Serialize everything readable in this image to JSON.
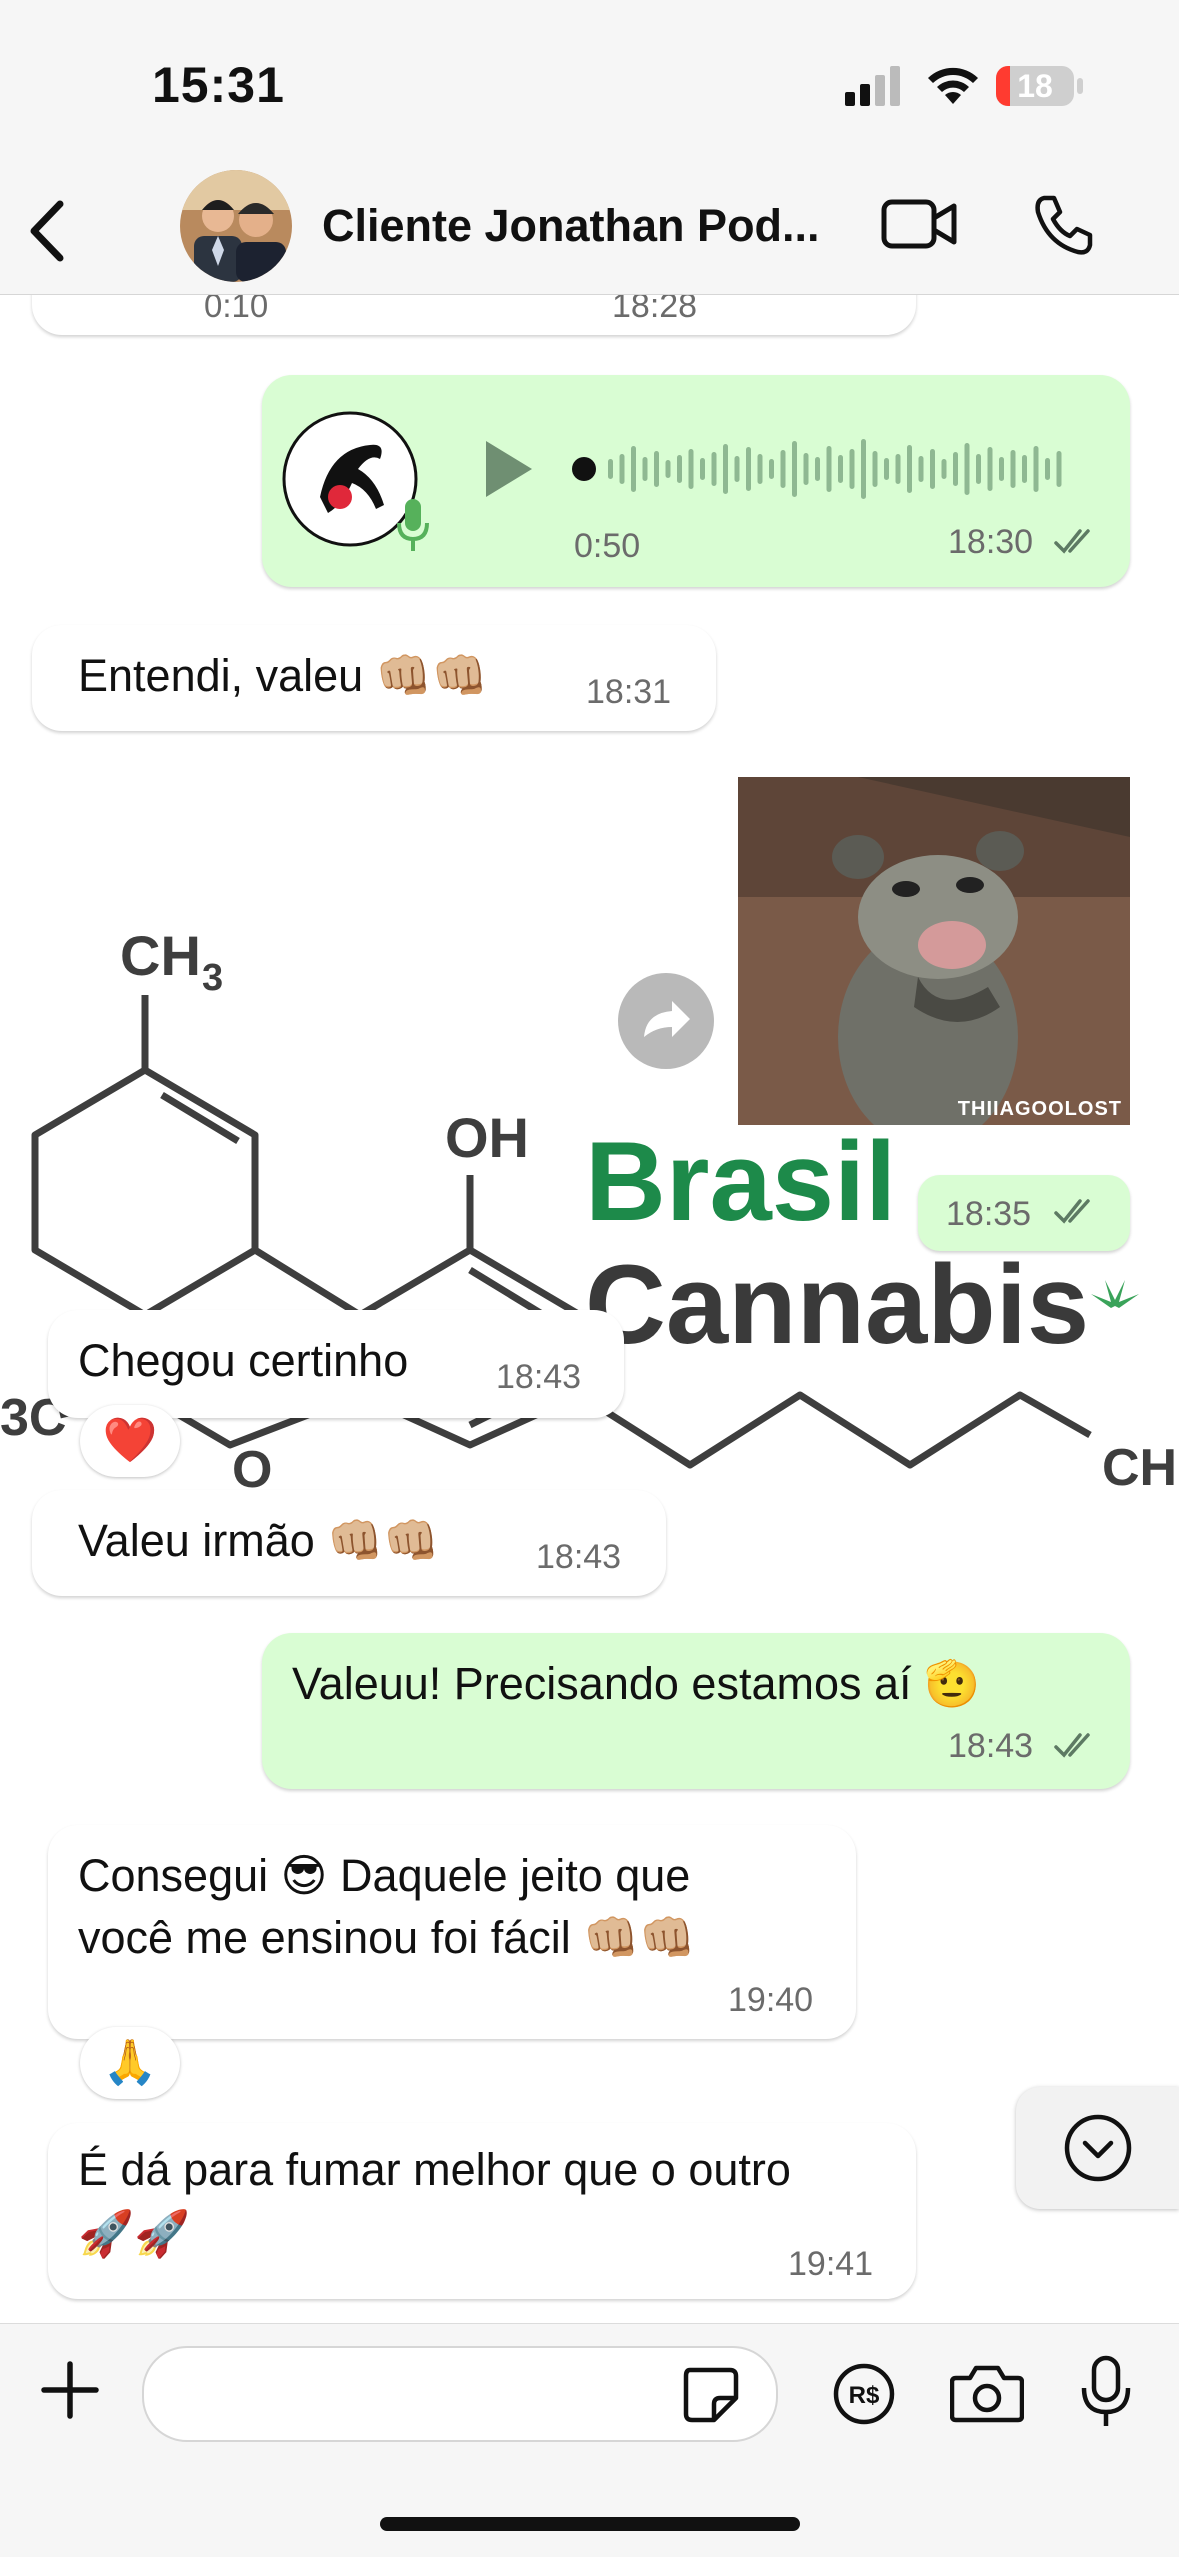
{
  "status_bar": {
    "time": "15:31",
    "battery": "18",
    "battery_level": 0.18,
    "battery_color": "#ff3b30"
  },
  "header": {
    "contact_name": "Cliente Jonathan Pod..."
  },
  "wallpaper": {
    "ch3_top": "CH",
    "oh": "OH",
    "brand_line1": "Brasil",
    "brand_line2": "Cannabis",
    "ch3_left": "3C",
    "o_label": "O",
    "ch_right": "CH",
    "brand_color": "#1d8a4a"
  },
  "messages": [
    {
      "id": "m0",
      "direction": "in",
      "type": "audio-partial",
      "duration": "0:10",
      "time": "18:28"
    },
    {
      "id": "m1",
      "direction": "out",
      "type": "audio",
      "duration": "0:50",
      "time": "18:30",
      "status": "read"
    },
    {
      "id": "m2",
      "direction": "in",
      "type": "text",
      "text": "Entendi, valeu 👊🏼👊🏼",
      "time": "18:31"
    },
    {
      "id": "m3",
      "direction": "out",
      "type": "gif",
      "caption": "THIIAGOOLOST",
      "time": "18:35",
      "status": "read"
    },
    {
      "id": "m4",
      "direction": "in",
      "type": "text",
      "text": "Chegou certinho",
      "time": "18:43",
      "reaction": "❤️"
    },
    {
      "id": "m5",
      "direction": "in",
      "type": "text",
      "text": "Valeu irmão 👊🏼👊🏼",
      "time": "18:43"
    },
    {
      "id": "m6",
      "direction": "out",
      "type": "text",
      "text": "Valeuu! Precisando estamos aí 🫡",
      "time": "18:43",
      "status": "read"
    },
    {
      "id": "m7",
      "direction": "in",
      "type": "text",
      "lines": [
        "Consegui 😎 Daquele jeito que",
        "você me ensinou foi fácil 👊🏼👊🏼"
      ],
      "time": "19:40",
      "reaction": "🙏"
    },
    {
      "id": "m8",
      "direction": "in",
      "type": "text",
      "lines": [
        "É dá para fumar melhor que o outro",
        "🚀🚀"
      ],
      "time": "19:41"
    }
  ],
  "input": {
    "placeholder": ""
  },
  "icons": {
    "back": "chevron-left-icon",
    "video": "video-camera-icon",
    "phone": "phone-icon",
    "forward": "forward-icon",
    "scroll": "chevron-down-icon",
    "plus": "plus-icon",
    "sticker": "sticker-icon",
    "payment": "payment-icon",
    "camera": "camera-icon",
    "mic": "microphone-icon"
  },
  "colors": {
    "outgoing_bubble": "#d9fdd3",
    "incoming_bubble": "#ffffff",
    "ticks": "#5d7a63"
  }
}
